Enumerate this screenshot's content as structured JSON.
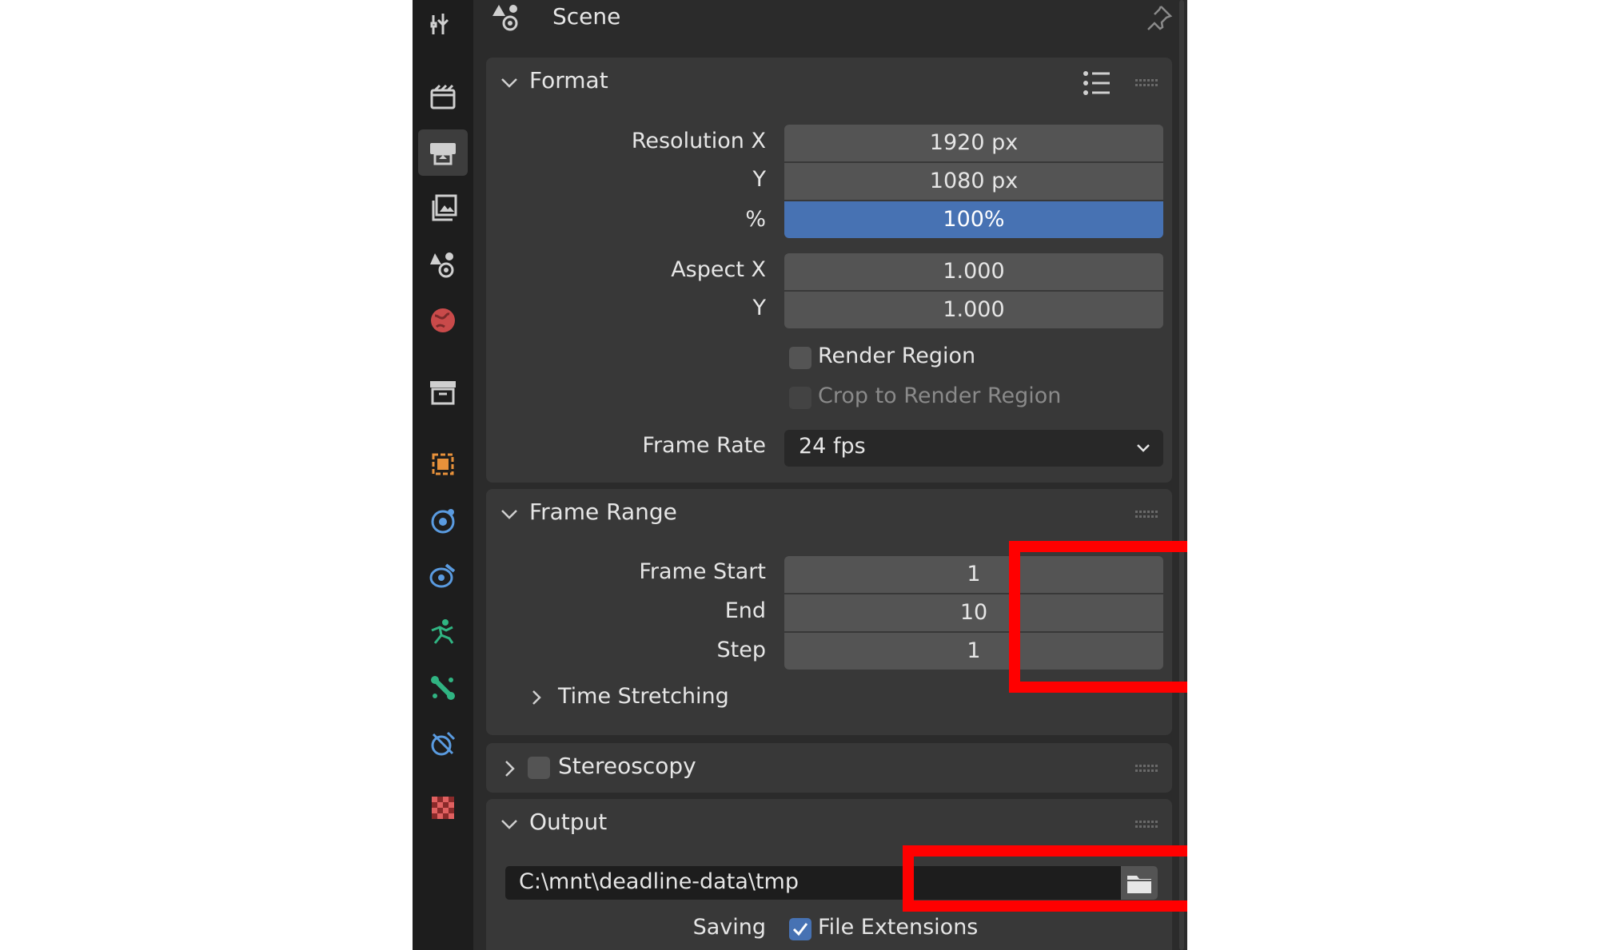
{
  "header": {
    "title": "Scene"
  },
  "format": {
    "title": "Format",
    "resolution_x_label": "Resolution X",
    "resolution_x": "1920 px",
    "resolution_y_label": "Y",
    "resolution_y": "1080 px",
    "percent_label": "%",
    "percent": "100%",
    "aspect_x_label": "Aspect X",
    "aspect_x": "1.000",
    "aspect_y_label": "Y",
    "aspect_y": "1.000",
    "render_region": "Render Region",
    "render_region_checked": false,
    "crop_region": "Crop to Render Region",
    "crop_region_checked": false,
    "frame_rate_label": "Frame Rate",
    "frame_rate": "24 fps"
  },
  "frame_range": {
    "title": "Frame Range",
    "start_label": "Frame Start",
    "start": "1",
    "end_label": "End",
    "end": "10",
    "step_label": "Step",
    "step": "1",
    "time_stretching": "Time Stretching"
  },
  "stereoscopy": {
    "title": "Stereoscopy",
    "enabled": false
  },
  "output": {
    "title": "Output",
    "path": "C:\\mnt\\deadline-data\\tmp",
    "saving_label": "Saving",
    "file_extensions": "File Extensions",
    "file_extensions_checked": true
  },
  "sidebar_tabs": [
    "tool-icon",
    "render-icon",
    "output-icon",
    "view-layer-icon",
    "scene-icon",
    "world-icon",
    "collection-icon",
    "object-icon",
    "modifier-icon",
    "particles-icon",
    "physics-icon",
    "constraints-icon",
    "data-icon",
    "material-icon"
  ],
  "colors": {
    "accent": "#4772b3",
    "highlight": "#ff0000",
    "panel": "#383838",
    "background": "#2b2b2b"
  }
}
